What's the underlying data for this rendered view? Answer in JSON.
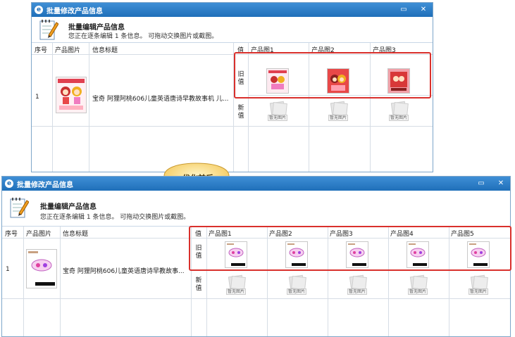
{
  "window": {
    "title": "批量修改产品信息",
    "app_icon": "e",
    "restore_symbol": "▭",
    "close_symbol": "✕"
  },
  "header": {
    "title": "批量编辑产品信息",
    "subtitle": "您正在逐条编辑 1 条信息。 可拖动交换图片或截图。"
  },
  "columns": {
    "seq": "序号",
    "image": "产品图片",
    "info_title": "信息标题",
    "value": "值"
  },
  "row": {
    "seq": "1",
    "title_top": "宝奇 阿狸阿桃606儿童英语唐诗早教故事机 儿...",
    "title_bottom": "宝奇 阿狸阿桃606儿童英语唐诗早教故事..."
  },
  "value_labels": {
    "old": [
      "旧",
      "值"
    ],
    "new": [
      "新",
      "值"
    ]
  },
  "top_slots": [
    "产品图1",
    "产品图2",
    "产品图3"
  ],
  "bottom_slots": [
    "产品图1",
    "产品图2",
    "产品图3",
    "产品图4",
    "产品图5"
  ],
  "no_image_label": "暂无图片",
  "callout": "优化前后",
  "colors": {
    "titlebar": "#1f6fb9",
    "highlight_box": "#d9302c",
    "callout_fill": "#fbe08a"
  }
}
